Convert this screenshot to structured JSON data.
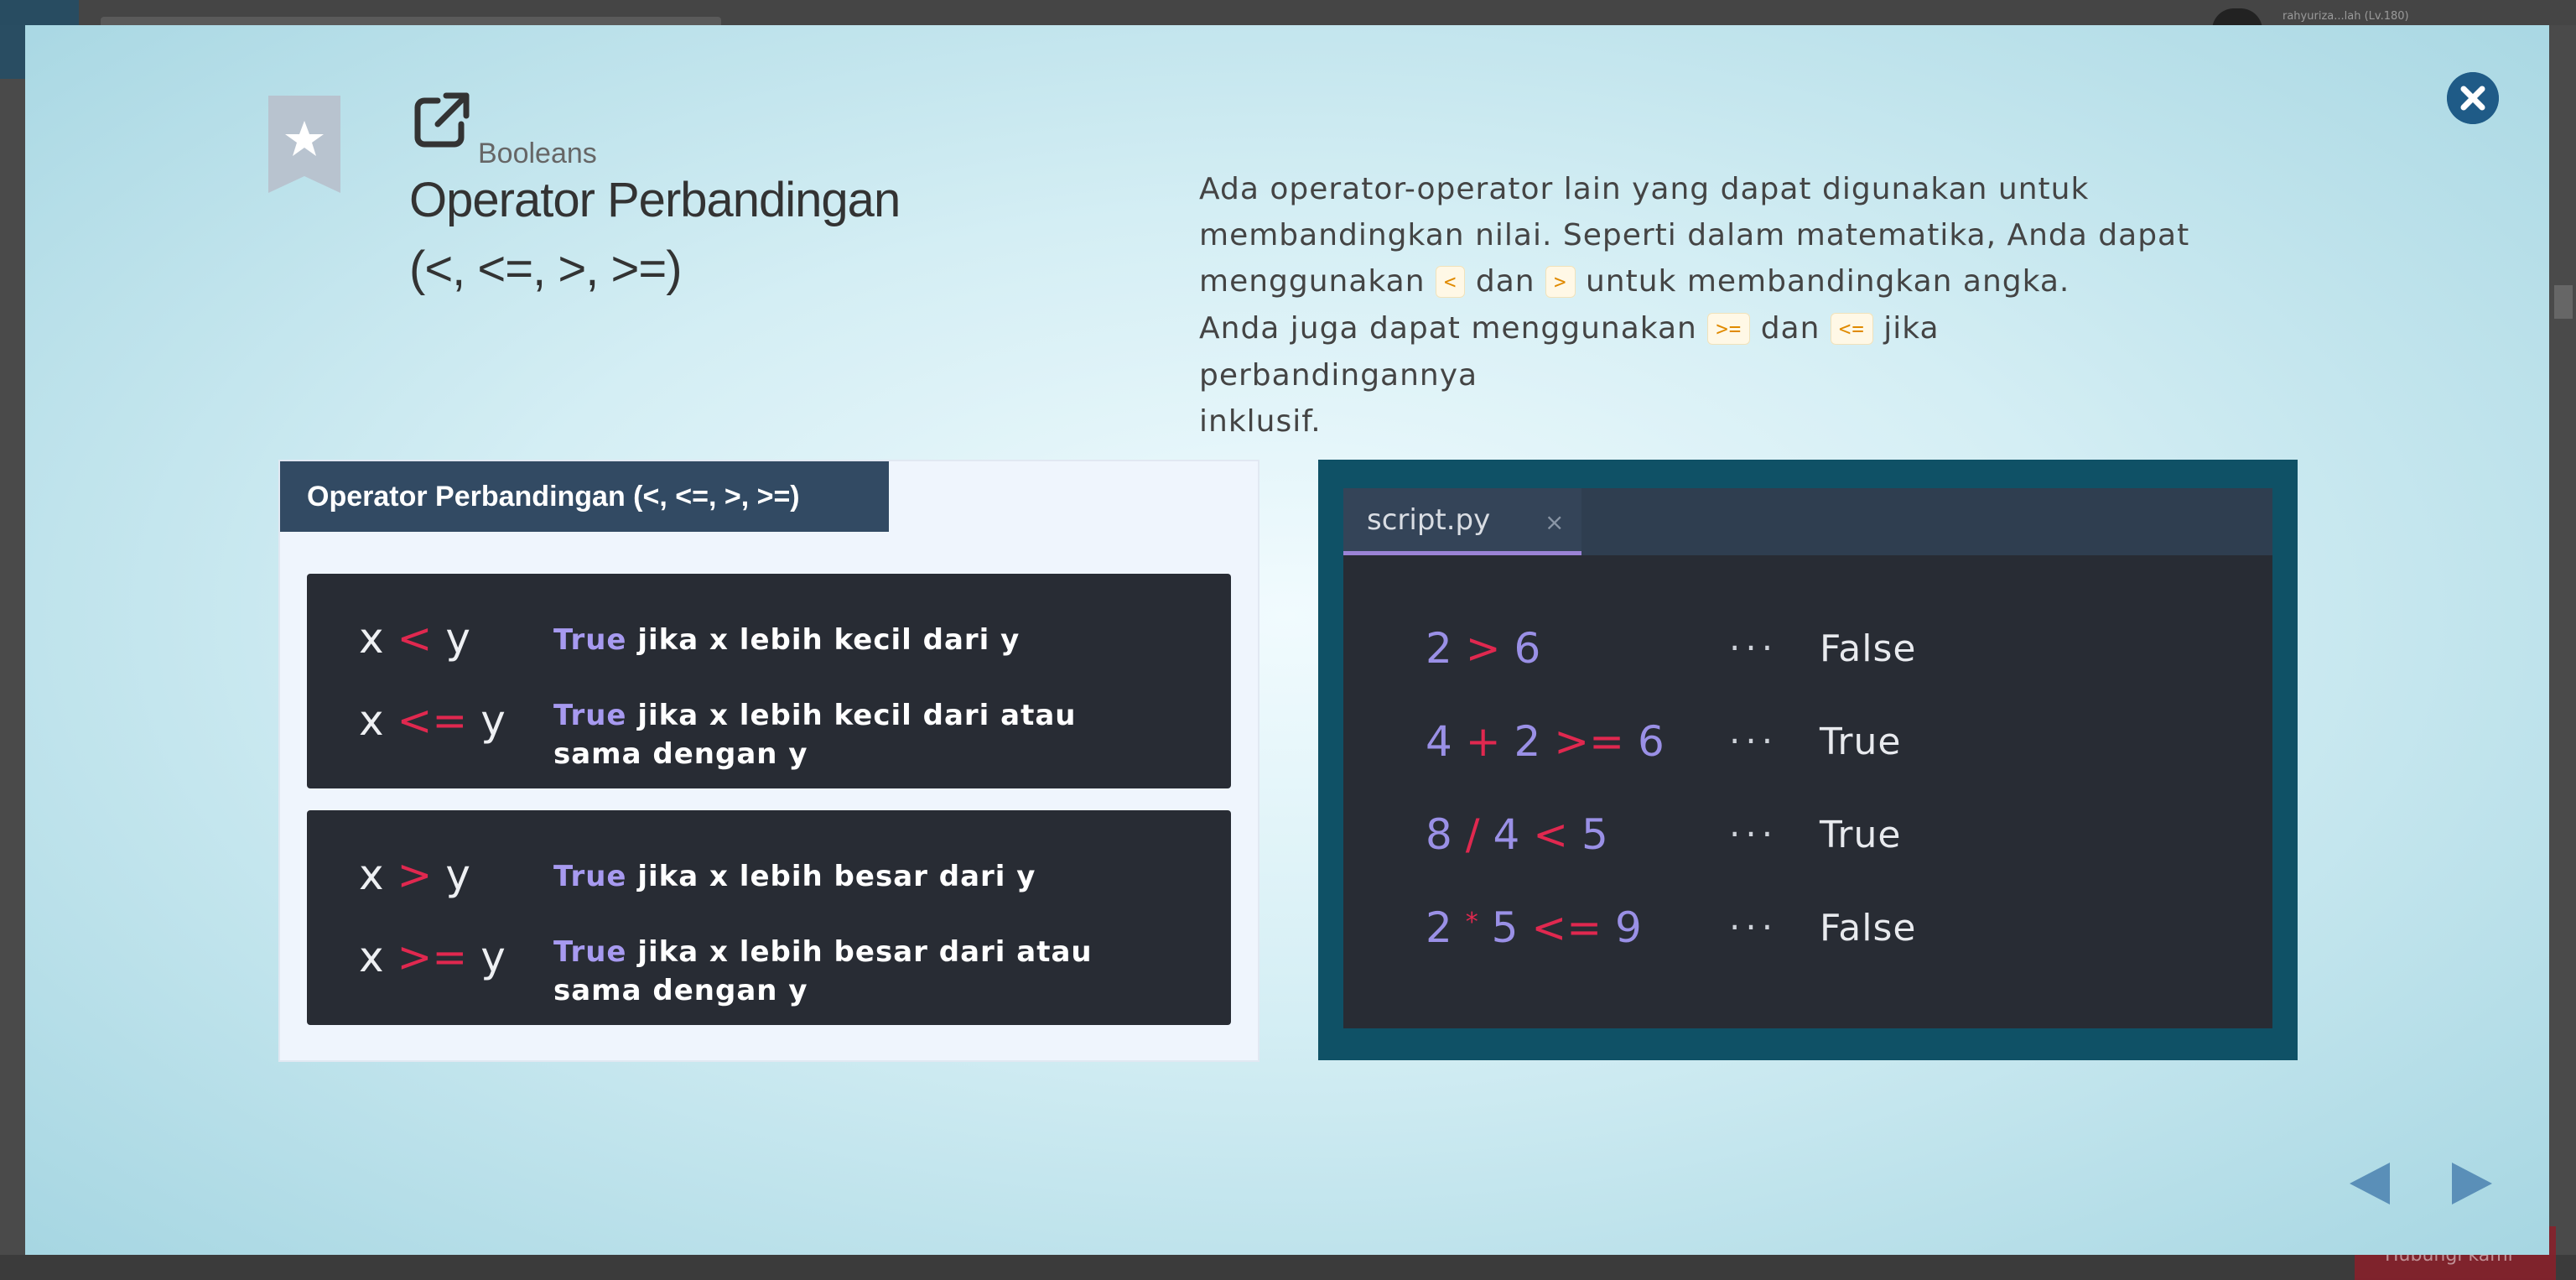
{
  "background": {
    "user_label": "rahyuriza...lah (Lv.180)",
    "bottom_button_label": "Hubungi kami"
  },
  "modal": {
    "topic": "Booleans",
    "title_line1": "Operator Perbandingan",
    "title_line2": "(<, <=, >, >=)",
    "description": {
      "line1": "Ada operator-operator lain yang dapat digunakan untuk",
      "line2": "membandingkan nilai. Seperti dalam matematika, Anda dapat",
      "line3_a": "menggunakan",
      "code_lt": "<",
      "line3_b": "dan",
      "code_gt": ">",
      "line3_c": "untuk membandingkan angka.",
      "line4_a": "Anda juga dapat menggunakan",
      "code_gte": ">=",
      "line4_b": "dan",
      "code_lte": "<=",
      "line4_c": "jika perbandingannya",
      "line5": "inklusif."
    },
    "cheatsheet": {
      "title": "Operator Perbandingan (<, <=, >, >=)",
      "true_kw": "True",
      "rows": [
        {
          "lhs": "x",
          "op": "<",
          "rhs": "y",
          "desc": "jika x lebih kecil dari y"
        },
        {
          "lhs": "x",
          "op": "<=",
          "rhs": "y",
          "desc": "jika x lebih kecil dari atau sama dengan y"
        },
        {
          "lhs": "x",
          "op": ">",
          "rhs": "y",
          "desc": "jika x lebih besar dari y"
        },
        {
          "lhs": "x",
          "op": ">=",
          "rhs": "y",
          "desc": "jika x lebih besar dari atau sama dengan y"
        }
      ]
    },
    "editor": {
      "tab_name": "script.py",
      "tab_close": "×",
      "dots": "···",
      "lines": [
        {
          "a": "2",
          "op1": ">",
          "b": "6",
          "op2": "",
          "c": "",
          "result": "False"
        },
        {
          "a": "4",
          "op1": "+",
          "b": "2",
          "op2": ">=",
          "c": "6",
          "result": "True"
        },
        {
          "a": "8",
          "op1": "/",
          "b": "4",
          "op2": "<",
          "c": "5",
          "result": "True"
        },
        {
          "a": "2",
          "op1": "*",
          "b": "5",
          "op2": "<=",
          "c": "9",
          "result": "False"
        }
      ]
    },
    "colors": {
      "operator_red": "#e0284f",
      "keyword_purple": "#a79af0",
      "code_orange": "#e08a00",
      "header_navy": "#324a63",
      "close_blue": "#1f5b87",
      "nav_blue": "#5a8fb8"
    }
  }
}
